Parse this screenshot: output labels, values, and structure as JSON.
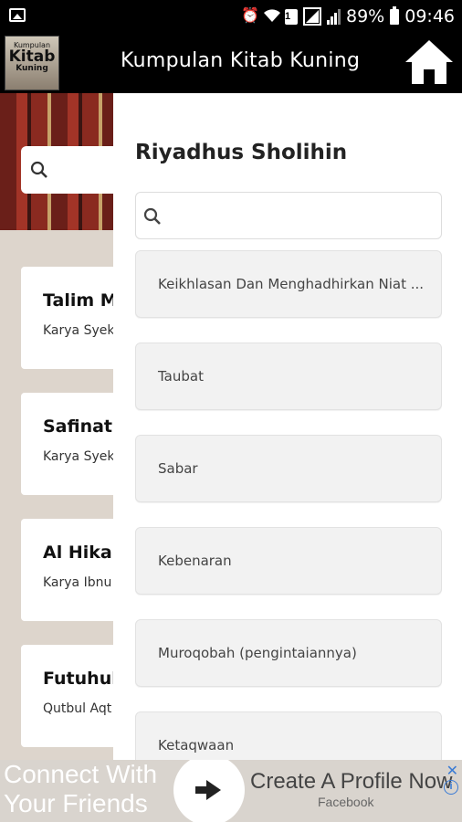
{
  "status_bar": {
    "battery": "89%",
    "time": "09:46",
    "sim_badge": "1"
  },
  "app_bar": {
    "title": "Kumpulan Kitab Kuning",
    "logo_lines": [
      "Kumpulan",
      "Kitab",
      "Kuning"
    ]
  },
  "background_list": {
    "search_placeholder": "",
    "cards": [
      {
        "title": "Talim M",
        "subtitle": "Karya Syek"
      },
      {
        "title": "Safinatu",
        "subtitle": "Karya Syek"
      },
      {
        "title": "Al Hikar",
        "subtitle": "Karya Ibnu"
      },
      {
        "title": "Futuhul",
        "subtitle": "Qutbul Aqt"
      }
    ]
  },
  "drawer": {
    "title": "Riyadhus Sholihin",
    "search_value": "",
    "chapters": [
      "Keikhlasan Dan Menghadhirkan Niat ...",
      "Taubat",
      "Sabar",
      "Kebenaran",
      "Muroqobah (pengintaiannya)",
      "Ketaqwaan"
    ]
  },
  "ad": {
    "left_line1": "Connect With",
    "left_line2": "Your Friends",
    "headline": "Create A Profile Now",
    "advertiser": "Facebook",
    "close_glyph": "✕",
    "info_glyph": "i"
  },
  "colors": {
    "app_bar": "#000000",
    "drawer_bg": "#ffffff",
    "chapter_bg": "#f2f2f2",
    "ad_accent": "#3a7bd5"
  }
}
